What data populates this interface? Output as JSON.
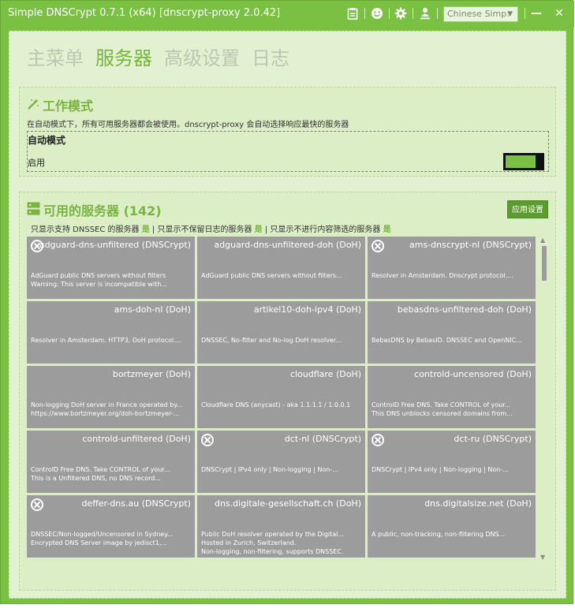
{
  "window": {
    "title": "Simple DNSCrypt 0.7.1 (x64) [dnscrypt-proxy 2.0.42]",
    "language": "Chinese Simp.",
    "icons": [
      "clipboard-icon",
      "smiley-icon",
      "gear-icon",
      "person-download-icon",
      "minimize-icon",
      "close-icon"
    ],
    "minimize": "—",
    "close": "✕"
  },
  "nav": {
    "tabs": [
      "主菜单",
      "服务器",
      "高级设置",
      "日志"
    ],
    "active": "服务器"
  },
  "mode": {
    "title": "工作模式",
    "description": "在自动模式下，所有可用服务器都会被使用。dnscrypt-proxy 会自动选择响应最快的服务器",
    "label": "自动模式",
    "enable_label": "启用",
    "enabled": true
  },
  "servers": {
    "title": "可用的服务器 (142)",
    "apply_label": "应用设置",
    "filter": {
      "dnssec_text": "只显示支持 DNSSEC 的服务器",
      "dnssec_value": "是",
      "sep1": "|",
      "nolog_text": "只显示不保留日志的服务器",
      "nolog_value": "是",
      "sep2": "|",
      "nofilter_text": "只显示不进行内容筛选的服务器",
      "nofilter_value": "是"
    },
    "list": [
      {
        "name": "adguard-dns-unfiltered (DNSCrypt)",
        "desc": "AdGuard public DNS servers without filters\nWarning: This server is incompatible with...",
        "icon": "no-log-icon"
      },
      {
        "name": "adguard-dns-unfiltered-doh (DoH)",
        "desc": "AdGuard public DNS servers without filters...",
        "icon": ""
      },
      {
        "name": "ams-dnscrypt-nl (DNSCrypt)",
        "desc": "Resolver in Amsterdam. Dnscrypt protocol....",
        "icon": "no-log-icon"
      },
      {
        "name": "ams-doh-nl (DoH)",
        "desc": "Resolver in Amsterdam. HTTP3, DoH protocol....",
        "icon": ""
      },
      {
        "name": "artikel10-doh-ipv4 (DoH)",
        "desc": "DNSSEC, No-filter and No-log DoH resolver...",
        "icon": ""
      },
      {
        "name": "bebasdns-unfiltered-doh (DoH)",
        "desc": "BebasDNS by BebasID. DNSSEC and OpenNIC...",
        "icon": ""
      },
      {
        "name": "bortzmeyer (DoH)",
        "desc": "Non-logging DoH server in France operated by...\nhttps://www.bortzmeyer.org/doh-bortzmeyer-...",
        "icon": ""
      },
      {
        "name": "cloudflare (DoH)",
        "desc": "Cloudflare DNS (anycast) - aka 1.1.1.1 / 1.0.0.1",
        "icon": ""
      },
      {
        "name": "controld-uncensored (DoH)",
        "desc": "ControlD Free DNS. Take CONTROL of your...\nThis DNS unblocks censored domains from...",
        "icon": ""
      },
      {
        "name": "controld-unfiltered (DoH)",
        "desc": "ControlD Free DNS. Take CONTROL of your...\nThis is a Unfiltered DNS, no DNS record...",
        "icon": ""
      },
      {
        "name": "dct-nl (DNSCrypt)",
        "desc": "DNSCrypt | IPv4 only | Non-logging | Non-...",
        "icon": "no-log-icon"
      },
      {
        "name": "dct-ru (DNSCrypt)",
        "desc": "DNSCrypt | IPv4 only | Non-logging | Non-...",
        "icon": "no-log-icon"
      },
      {
        "name": "deffer-dns.au (DNSCrypt)",
        "desc": "DNSSEC/Non-logged/Uncensored in Sydney...\nEncrypted DNS Server image by jedisct1,...",
        "icon": "no-log-icon"
      },
      {
        "name": "dns.digitale-gesellschaft.ch (DoH)",
        "desc": "Public DoH resolver operated by the Digital...\nHosted in Zurich, Switzerland.\nNon-logging, non-filtering, supports DNSSEC.",
        "icon": ""
      },
      {
        "name": "dns.digitalsize.net (DoH)",
        "desc": "A public, non-tracking, non-filtering DNS...",
        "icon": ""
      }
    ]
  }
}
